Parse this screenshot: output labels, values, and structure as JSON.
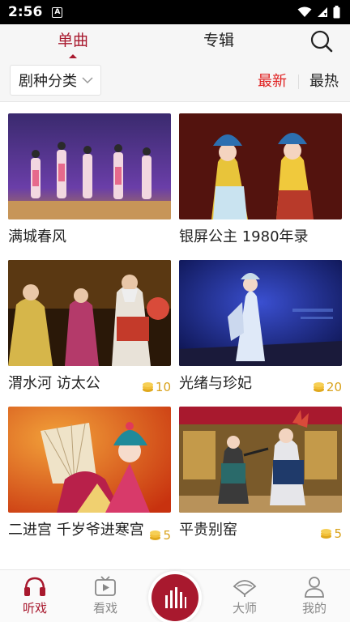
{
  "status_bar": {
    "time": "2:56",
    "notification_badge": "A"
  },
  "top_tabs": {
    "tabs": [
      {
        "label": "单曲",
        "active": true
      },
      {
        "label": "专辑",
        "active": false
      }
    ]
  },
  "filter": {
    "category_label": "剧种分类",
    "sort_latest": "最新",
    "sort_hot": "最热"
  },
  "items": [
    {
      "title": "满城春风",
      "coins": ""
    },
    {
      "title": "银屏公主 1980年录",
      "coins": ""
    },
    {
      "title": "渭水河 访太公",
      "coins": "10"
    },
    {
      "title": "光绪与珍妃",
      "coins": "20"
    },
    {
      "title": "二进宫 千岁爷进寒宫",
      "coins": "5"
    },
    {
      "title": "平贵别窑",
      "coins": "5"
    }
  ],
  "bottom_nav": {
    "items": [
      {
        "label": "听戏",
        "icon": "headphones-icon",
        "active": true
      },
      {
        "label": "看戏",
        "icon": "tv-icon",
        "active": false
      },
      {
        "label": "大师",
        "icon": "fan-icon",
        "active": false
      },
      {
        "label": "我的",
        "icon": "user-icon",
        "active": false
      }
    ],
    "center_icon": "equalizer-icon"
  },
  "colors": {
    "accent": "#a8192e",
    "sort_active": "#e02020",
    "coin": "#d9a21b"
  }
}
